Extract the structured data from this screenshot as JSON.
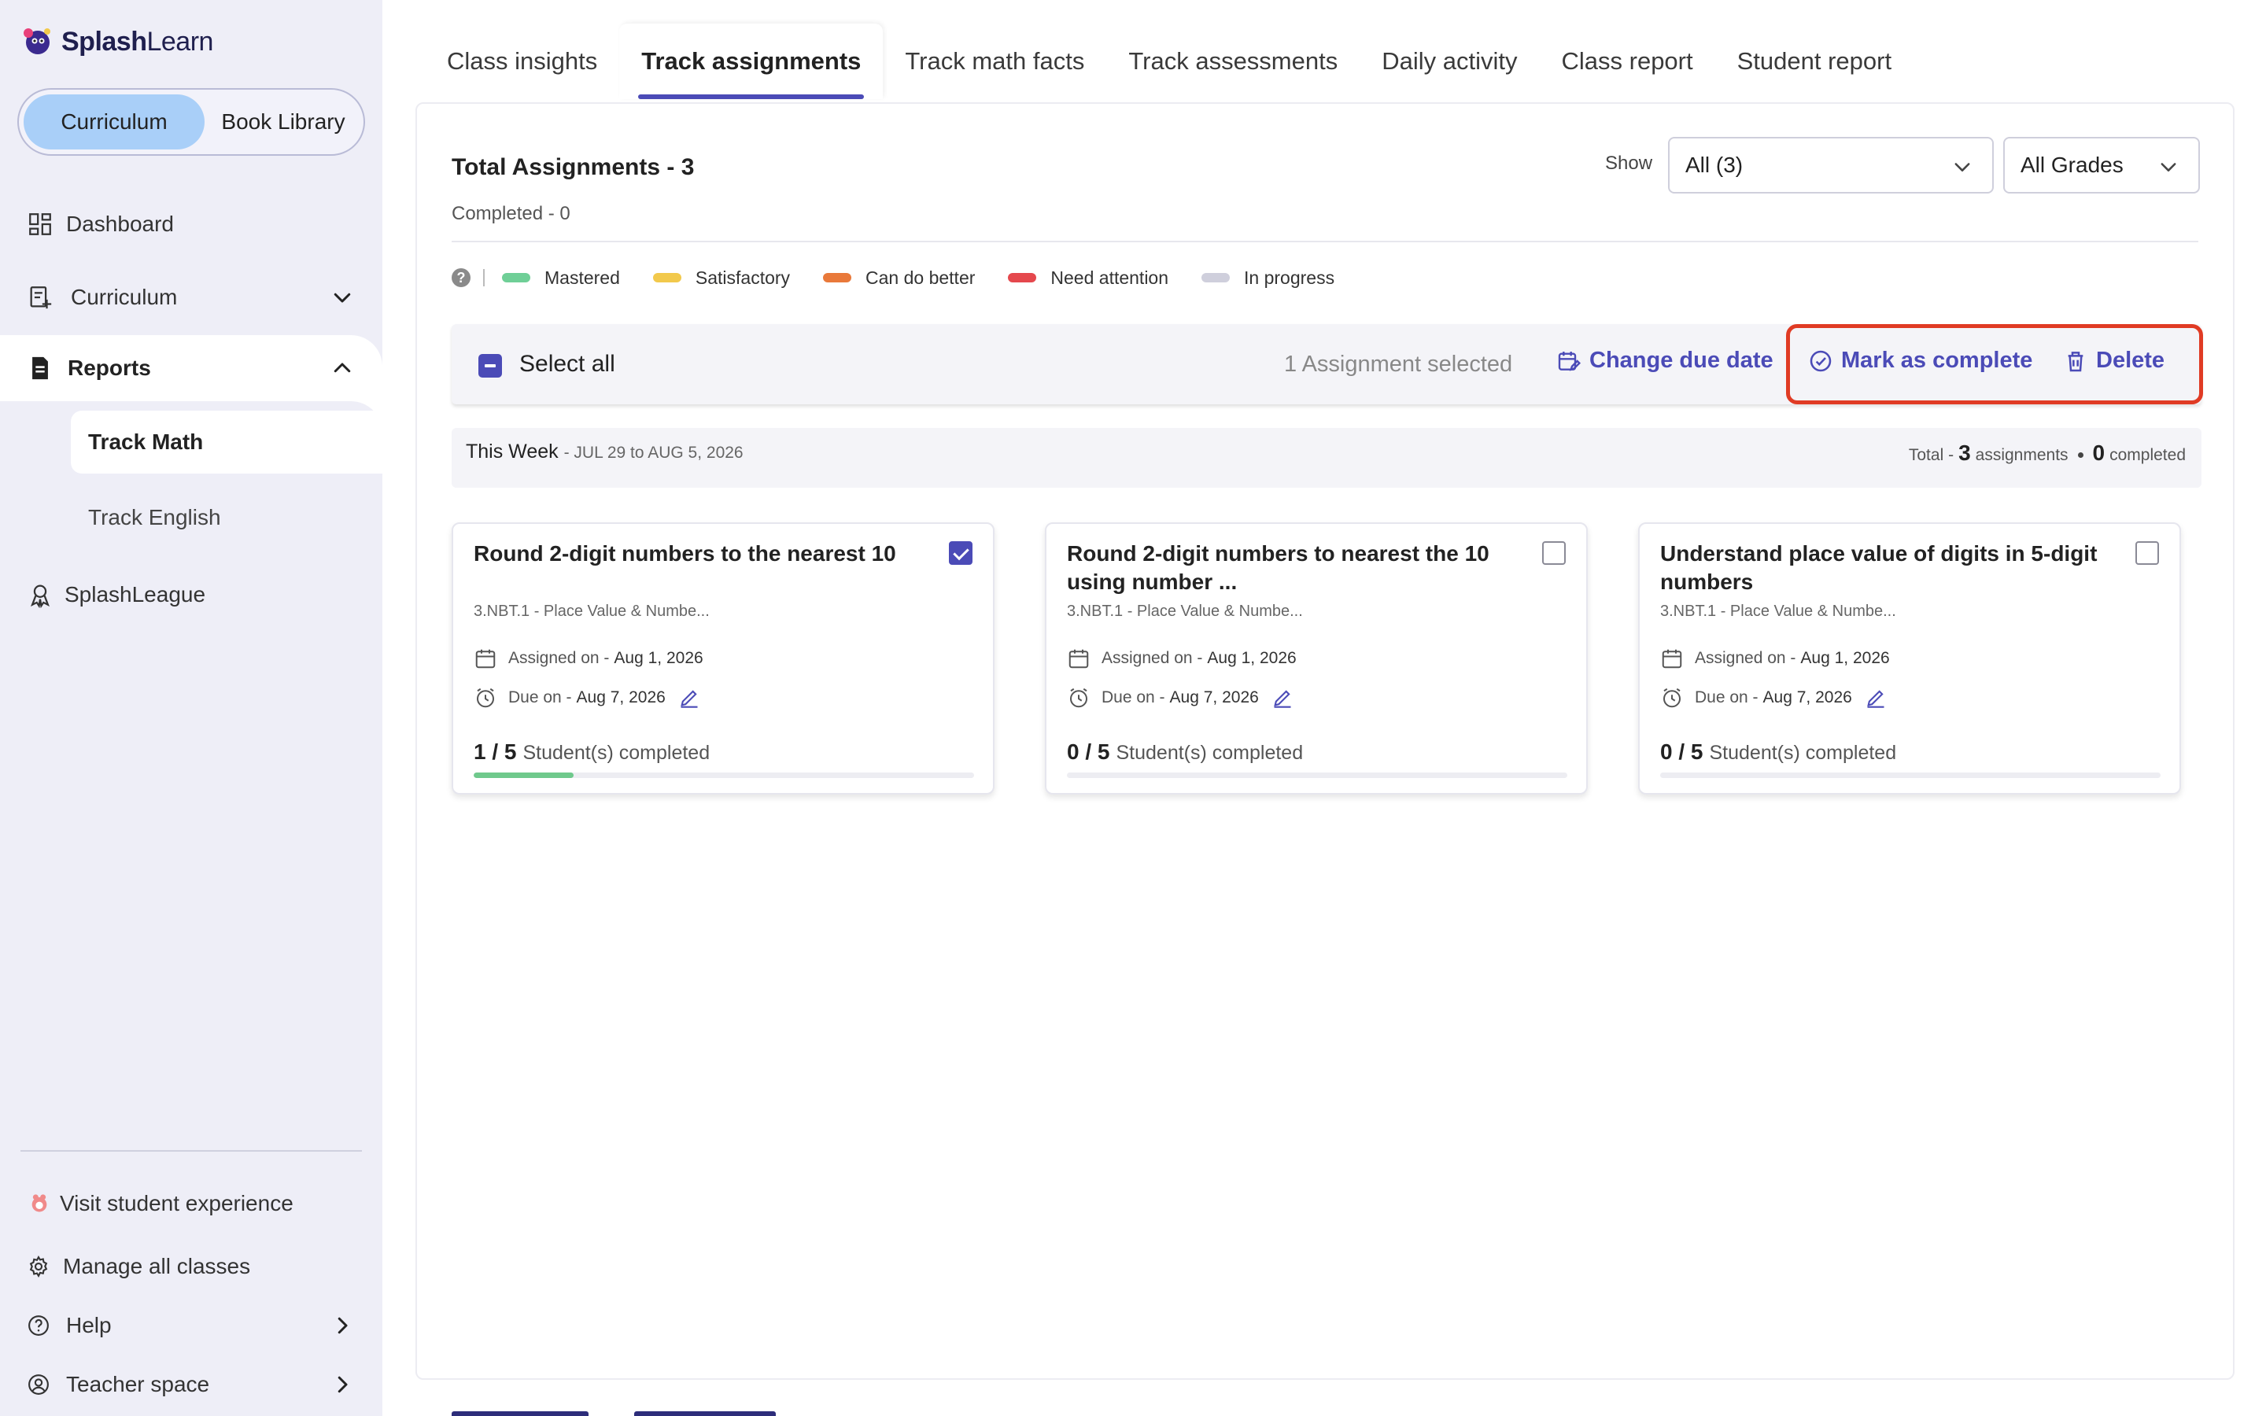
{
  "brand": {
    "name_part1": "Splash",
    "name_part2": "Learn"
  },
  "sidebar": {
    "toggle": {
      "active": "Curriculum",
      "inactive": "Book Library"
    },
    "items": {
      "dashboard": "Dashboard",
      "curriculum": "Curriculum",
      "reports": "Reports",
      "track_math": "Track Math",
      "track_english": "Track English",
      "splashleague": "SplashLeague"
    },
    "footer": {
      "visit_student": "Visit student experience",
      "manage_classes": "Manage all classes",
      "help": "Help",
      "teacher_space": "Teacher space"
    }
  },
  "tabs": [
    {
      "label": "Class insights"
    },
    {
      "label": "Track assignments",
      "active": true
    },
    {
      "label": "Track math facts"
    },
    {
      "label": "Track assessments"
    },
    {
      "label": "Daily activity"
    },
    {
      "label": "Class report"
    },
    {
      "label": "Student report"
    }
  ],
  "summary": {
    "total": "Total Assignments - 3",
    "completed": "Completed - 0",
    "show_label": "Show",
    "show_value": "All (3)",
    "grade_value": "All Grades"
  },
  "legend": [
    {
      "label": "Mastered",
      "color": "#6fcf97"
    },
    {
      "label": "Satisfactory",
      "color": "#f2c94c"
    },
    {
      "label": "Can do better",
      "color": "#e9793a"
    },
    {
      "label": "Need attention",
      "color": "#e5484d"
    },
    {
      "label": "In progress",
      "color": "#cfcfdc"
    }
  ],
  "action_bar": {
    "select_all": "Select all",
    "selected_count": "1 Assignment selected",
    "change_due_date": "Change due date",
    "mark_complete": "Mark as complete",
    "delete": "Delete"
  },
  "week": {
    "title": "This Week",
    "range": "- JUL 29 to AUG 5, 2026",
    "total_prefix": "Total -",
    "total_count": "3",
    "total_suffix": "assignments",
    "completed_count": "0",
    "completed_suffix": "completed"
  },
  "cards": [
    {
      "title": "Round 2-digit numbers to the nearest 10",
      "standard": "3.NBT.1 - Place Value & Numbe...",
      "assigned_label": "Assigned on -",
      "assigned_date": "Aug 1, 2026",
      "due_label": "Due on -",
      "due_date": "Aug 7, 2026",
      "progress": "1 / 5",
      "progress_label": "Student(s) completed",
      "progress_fraction": 0.2,
      "checked": true
    },
    {
      "title": "Round 2-digit numbers to nearest the 10 using number ...",
      "standard": "3.NBT.1 - Place Value & Numbe...",
      "assigned_label": "Assigned on -",
      "assigned_date": "Aug 1, 2026",
      "due_label": "Due on -",
      "due_date": "Aug 7, 2026",
      "progress": "0 / 5",
      "progress_label": "Student(s) completed",
      "progress_fraction": 0,
      "checked": false
    },
    {
      "title": "Understand place value of digits in 5-digit numbers",
      "standard": "3.NBT.1 - Place Value & Numbe...",
      "assigned_label": "Assigned on -",
      "assigned_date": "Aug 1, 2026",
      "due_label": "Due on -",
      "due_date": "Aug 7, 2026",
      "progress": "0 / 5",
      "progress_label": "Student(s) completed",
      "progress_fraction": 0,
      "checked": false
    }
  ],
  "colors": {
    "accent": "#4b4bb7",
    "highlight": "#e03b24",
    "progress": "#6fc98c",
    "sidebar_bg": "#eeeef7"
  }
}
